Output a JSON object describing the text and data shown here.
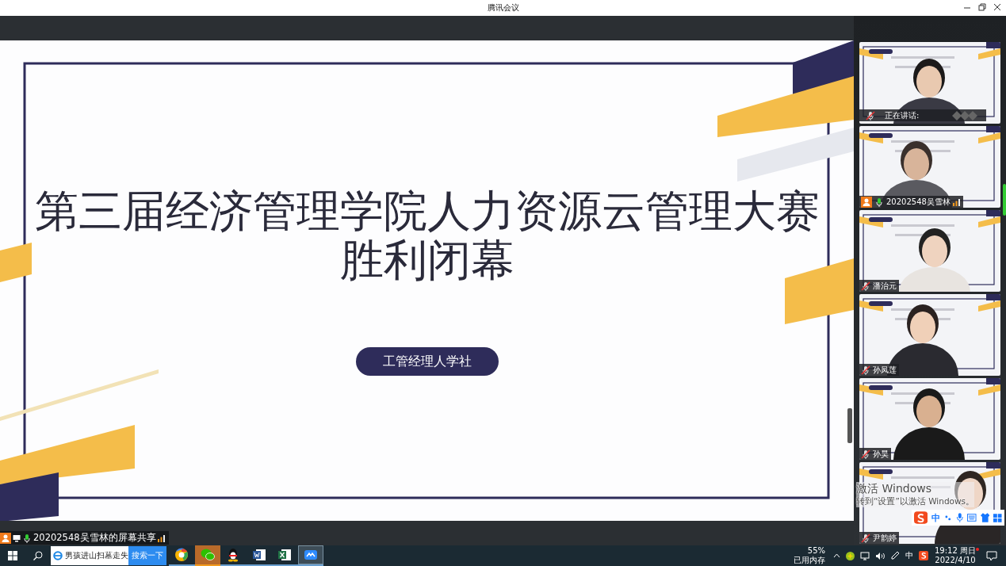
{
  "window": {
    "title": "腾讯会议"
  },
  "shared_slide": {
    "title_lines": [
      "第三届经济管理学院人力资源云管理大赛",
      "胜利闭幕"
    ],
    "badge": "工管经理人学社"
  },
  "share_status": {
    "label": "20202548吴雪林的屏幕共享",
    "host": true
  },
  "participants": [
    {
      "kind": "speaking",
      "label": "正在讲话:",
      "muted": true,
      "host": false
    },
    {
      "kind": "named",
      "label": "20202548吴雪林",
      "muted": false,
      "host": true
    },
    {
      "kind": "named",
      "label": "潘治元",
      "muted": true,
      "host": false
    },
    {
      "kind": "named",
      "label": "孙凤莲",
      "muted": true,
      "host": false
    },
    {
      "kind": "named",
      "label": "孙昊",
      "muted": true,
      "host": false
    },
    {
      "kind": "named",
      "label": "尹韵婷",
      "muted": true,
      "host": false
    }
  ],
  "activation_notice": {
    "title": "激活 Windows",
    "hint": "转到“设置”以激活 Windows。"
  },
  "ime_bar": {
    "mode": "中"
  },
  "taskbar": {
    "search": {
      "value": "男孩进山扫墓走失",
      "button": "搜索一下"
    },
    "apps": [
      {
        "kind": "browser",
        "selected": false,
        "attention": false
      },
      {
        "kind": "wechat",
        "selected": false,
        "attention": true
      },
      {
        "kind": "qq",
        "selected": false,
        "attention": false
      },
      {
        "kind": "word",
        "selected": false,
        "attention": false
      },
      {
        "kind": "excel",
        "selected": false,
        "attention": false
      },
      {
        "kind": "meeting",
        "selected": true,
        "attention": false
      }
    ],
    "memory": {
      "percent": "55%",
      "label": "已用内存"
    },
    "input_mode": "中",
    "clock": {
      "time": "19:12 周日",
      "date": "2022/4/10"
    }
  }
}
